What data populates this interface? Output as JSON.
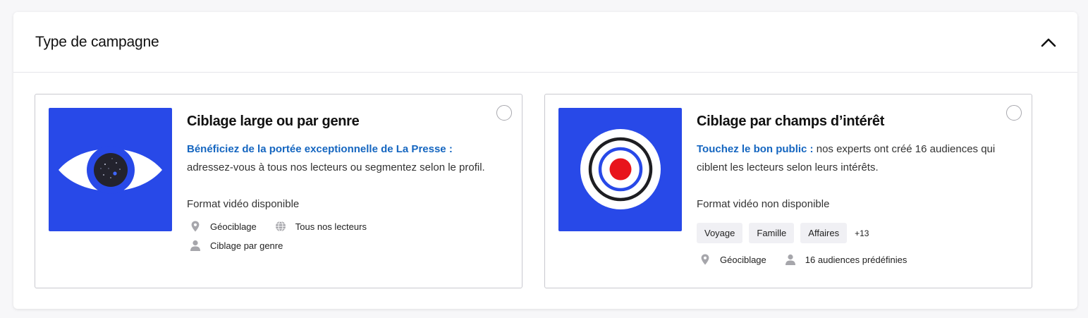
{
  "panel": {
    "title": "Type de campagne"
  },
  "cards": [
    {
      "title": "Ciblage large ou par genre",
      "highlight": "Bénéficiez de la portée exceptionnelle de La Presse :",
      "description": "adressez-vous à tous nos lecteurs ou segmentez selon le profil.",
      "format": "Format vidéo disponible",
      "features": [
        {
          "icon": "map-pin-icon",
          "label": "Géociblage"
        },
        {
          "icon": "globe-icon",
          "label": "Tous nos lecteurs"
        },
        {
          "icon": "person-icon",
          "label": "Ciblage par genre"
        }
      ]
    },
    {
      "title": "Ciblage par champs d’intérêt",
      "highlight": "Touchez le bon public :",
      "description": "nos experts ont créé 16 audiences qui ciblent les lecteurs selon leurs intérêts.",
      "format": "Format vidéo non disponible",
      "tags": [
        "Voyage",
        "Famille",
        "Affaires"
      ],
      "tags_more": "+13",
      "features": [
        {
          "icon": "map-pin-icon",
          "label": "Géociblage"
        },
        {
          "icon": "person-icon",
          "label": "16 audiences prédéfinies"
        }
      ]
    }
  ],
  "colors": {
    "brand_blue": "#2849e8",
    "link_blue": "#1566c0",
    "target_red": "#e8141c",
    "icon_gray": "#a6a6ab"
  }
}
